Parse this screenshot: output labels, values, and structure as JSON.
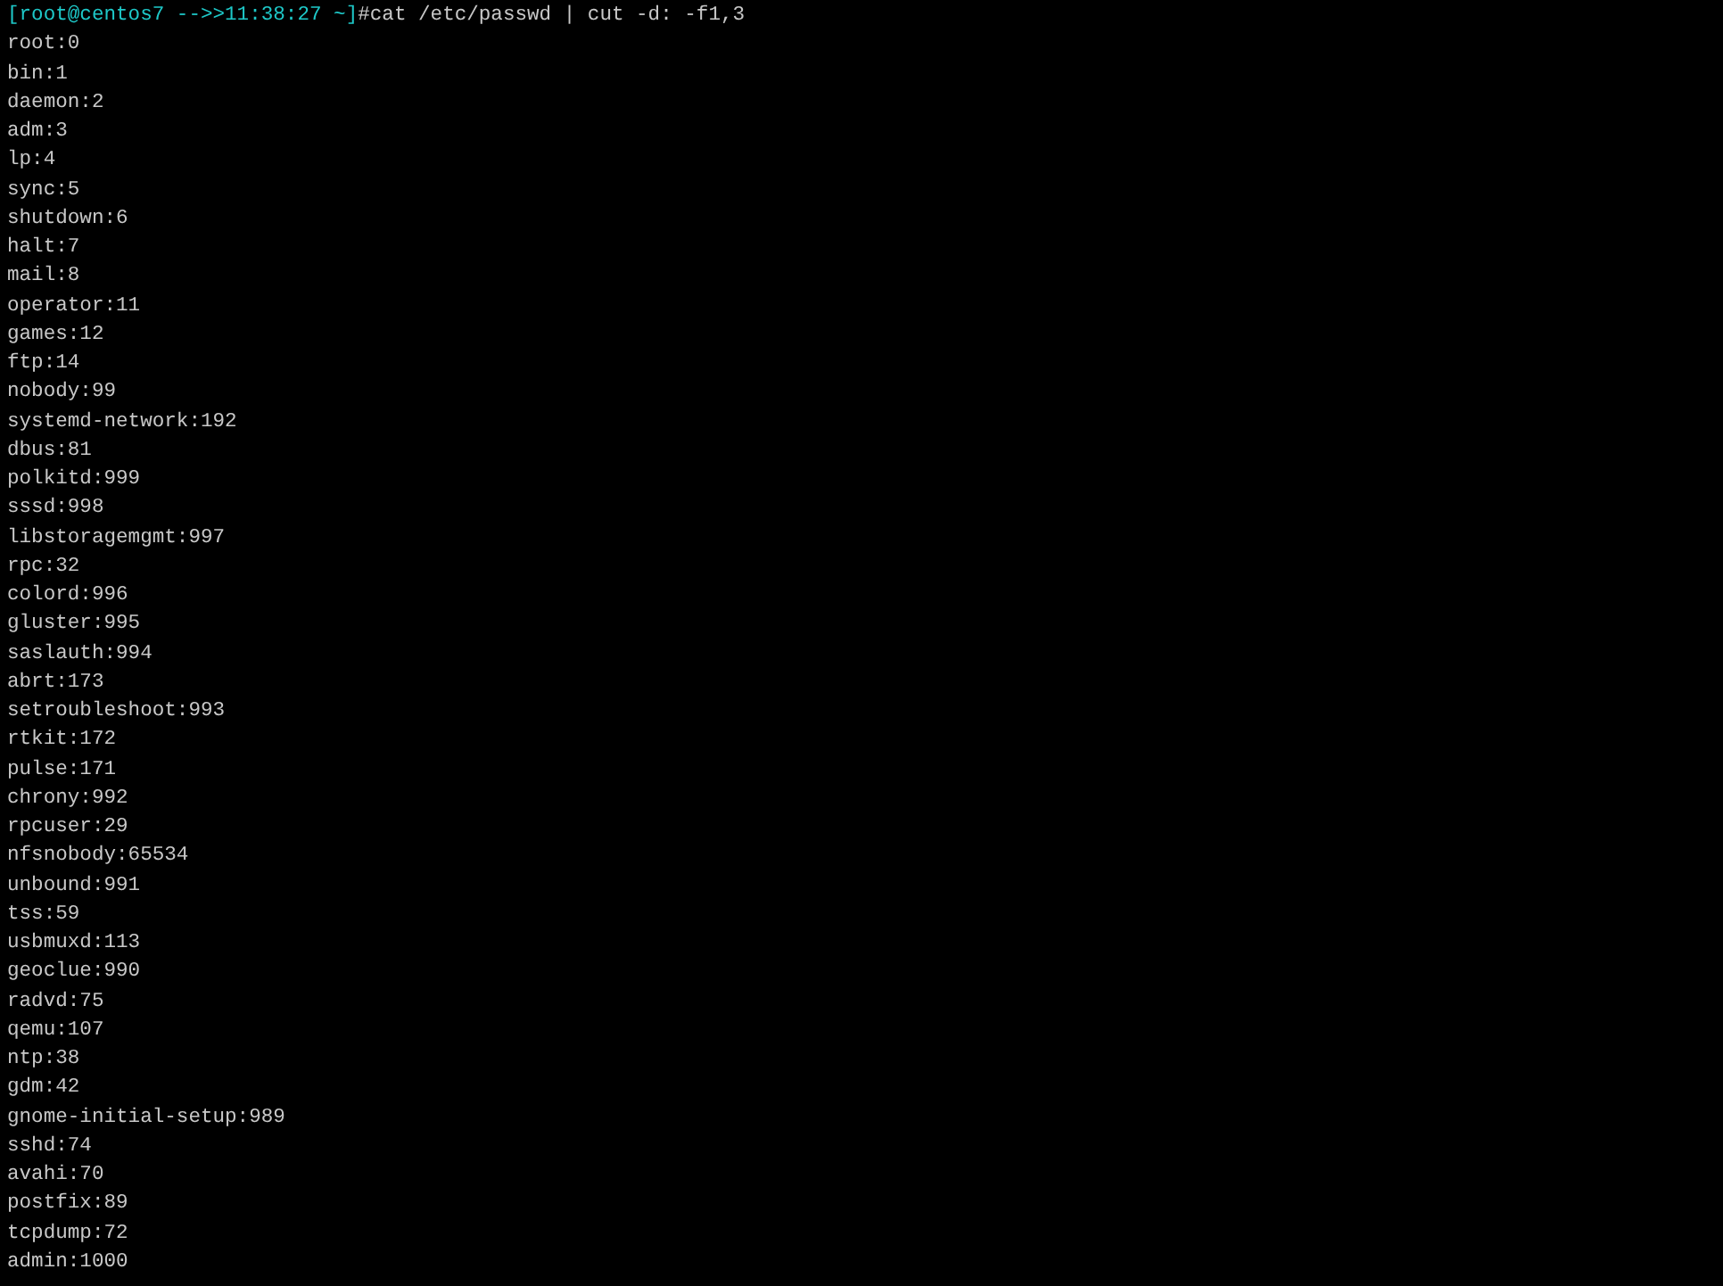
{
  "prompt": {
    "user_host": "[root@centos7 -->>11:38:27 ~]",
    "command": "#cat /etc/passwd | cut -d: -f1,3"
  },
  "output": [
    "root:0",
    "bin:1",
    "daemon:2",
    "adm:3",
    "lp:4",
    "sync:5",
    "shutdown:6",
    "halt:7",
    "mail:8",
    "operator:11",
    "games:12",
    "ftp:14",
    "nobody:99",
    "systemd-network:192",
    "dbus:81",
    "polkitd:999",
    "sssd:998",
    "libstoragemgmt:997",
    "rpc:32",
    "colord:996",
    "gluster:995",
    "saslauth:994",
    "abrt:173",
    "setroubleshoot:993",
    "rtkit:172",
    "pulse:171",
    "chrony:992",
    "rpcuser:29",
    "nfsnobody:65534",
    "unbound:991",
    "tss:59",
    "usbmuxd:113",
    "geoclue:990",
    "radvd:75",
    "qemu:107",
    "ntp:38",
    "gdm:42",
    "gnome-initial-setup:989",
    "sshd:74",
    "avahi:70",
    "postfix:89",
    "tcpdump:72",
    "admin:1000"
  ]
}
